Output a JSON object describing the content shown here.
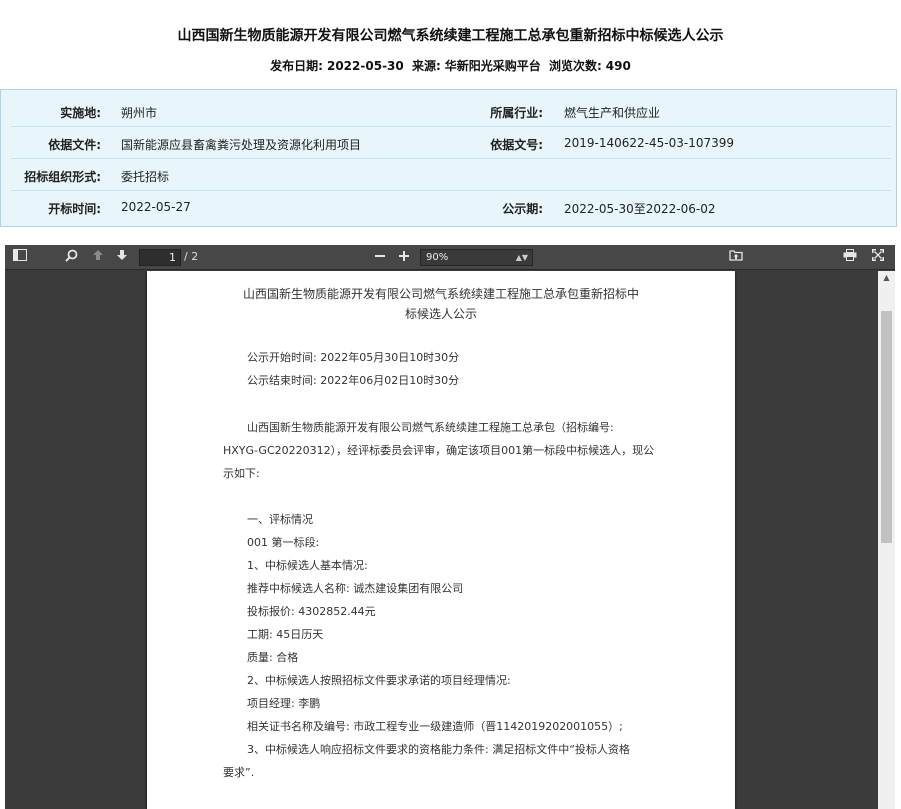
{
  "header": {
    "title": "山西国新生物质能源开发有限公司燃气系统续建工程施工总承包重新招标中标候选人公示",
    "publish_label": "发布日期:",
    "publish_date": "2022-05-30",
    "source_label": "来源:",
    "source": "华新阳光采购平台",
    "views_label": "浏览次数:",
    "views": "490"
  },
  "info": {
    "location_label": "实施地:",
    "location": "朔州市",
    "industry_label": "所属行业:",
    "industry": "燃气生产和供应业",
    "basis_doc_label": "依据文件:",
    "basis_doc": "国新能源应县畜禽粪污处理及资源化利用项目",
    "basis_no_label": "依据文号:",
    "basis_no": "2019-140622-45-03-107399",
    "org_form_label": "招标组织形式:",
    "org_form": "委托招标",
    "open_time_label": "开标时间:",
    "open_time": "2022-05-27",
    "notice_period_label": "公示期:",
    "notice_period": "2022-05-30至2022-06-02"
  },
  "viewer": {
    "icons": [
      "sidebar-toggle-icon",
      "search-icon",
      "previous-page-icon",
      "next-page-icon",
      "zoom-out-icon",
      "zoom-in-icon",
      "open-file-icon",
      "print-icon",
      "presentation-mode-icon"
    ],
    "page_current": "1",
    "page_total": "/ 2",
    "zoom": "90%"
  },
  "document": {
    "title_line1": "山西国新生物质能源开发有限公司燃气系统续建工程施工总承包重新招标中",
    "title_line2": "标候选人公示",
    "lines": [
      "公示开始时间: 2022年05月30日10时30分",
      "公示结束时间: 2022年06月02日10时30分",
      "山西国新生物质能源开发有限公司燃气系统续建工程施工总承包（招标编号:",
      "HXYG-GC20220312），经评标委员会评审，确定该项目001第一标段中标候选人，现公",
      "示如下:",
      "一、评标情况",
      "001 第一标段:",
      "1、中标候选人基本情况:",
      "推荐中标候选人名称: 诚杰建设集团有限公司",
      "投标报价: 4302852.44元",
      "工期: 45日历天",
      "质量: 合格",
      "2、中标候选人按照招标文件要求承诺的项目经理情况:",
      "项目经理: 李鹏",
      "相关证书名称及编号: 市政工程专业一级建造师（晋1142019202001055）;",
      "3、中标候选人响应招标文件要求的资格能力条件: 满足招标文件中“投标人资格",
      "要求”."
    ]
  }
}
